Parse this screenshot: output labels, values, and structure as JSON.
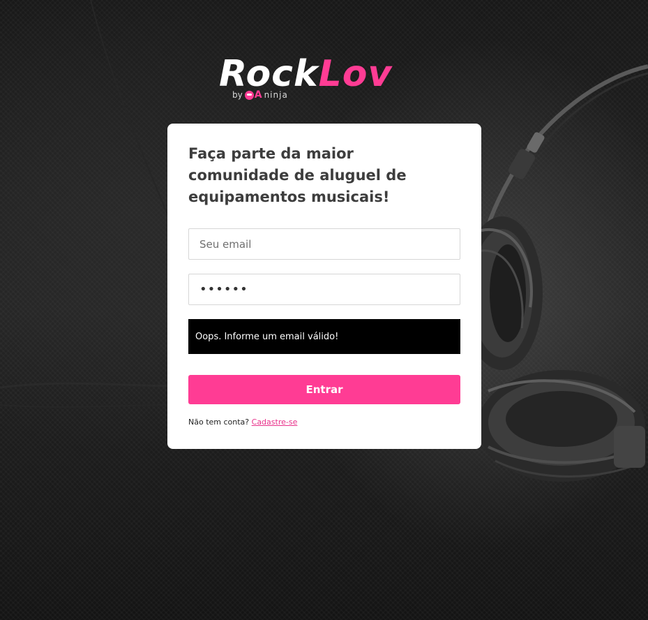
{
  "logo": {
    "word_part1": "Rock",
    "word_part2": "Lov",
    "by": "by",
    "badge": "A",
    "ninja": "ninja"
  },
  "form": {
    "title": "Faça parte da maior comunidade de aluguel de equipamentos musicais!",
    "email_placeholder": "Seu email",
    "email_value": "",
    "password_value": "••••••",
    "alert_message": "Oops. Informe um email válido!",
    "submit_label": "Entrar",
    "signup_prompt": "Não tem conta?",
    "signup_link": "Cadastre-se"
  },
  "colors": {
    "accent": "#ff3c94",
    "alert_bg": "#000000",
    "card_bg": "#ffffff",
    "title_text": "#3d3d3d"
  },
  "icons": {
    "background": "headphones-background-image",
    "badge": "qa-ninja-icon"
  }
}
